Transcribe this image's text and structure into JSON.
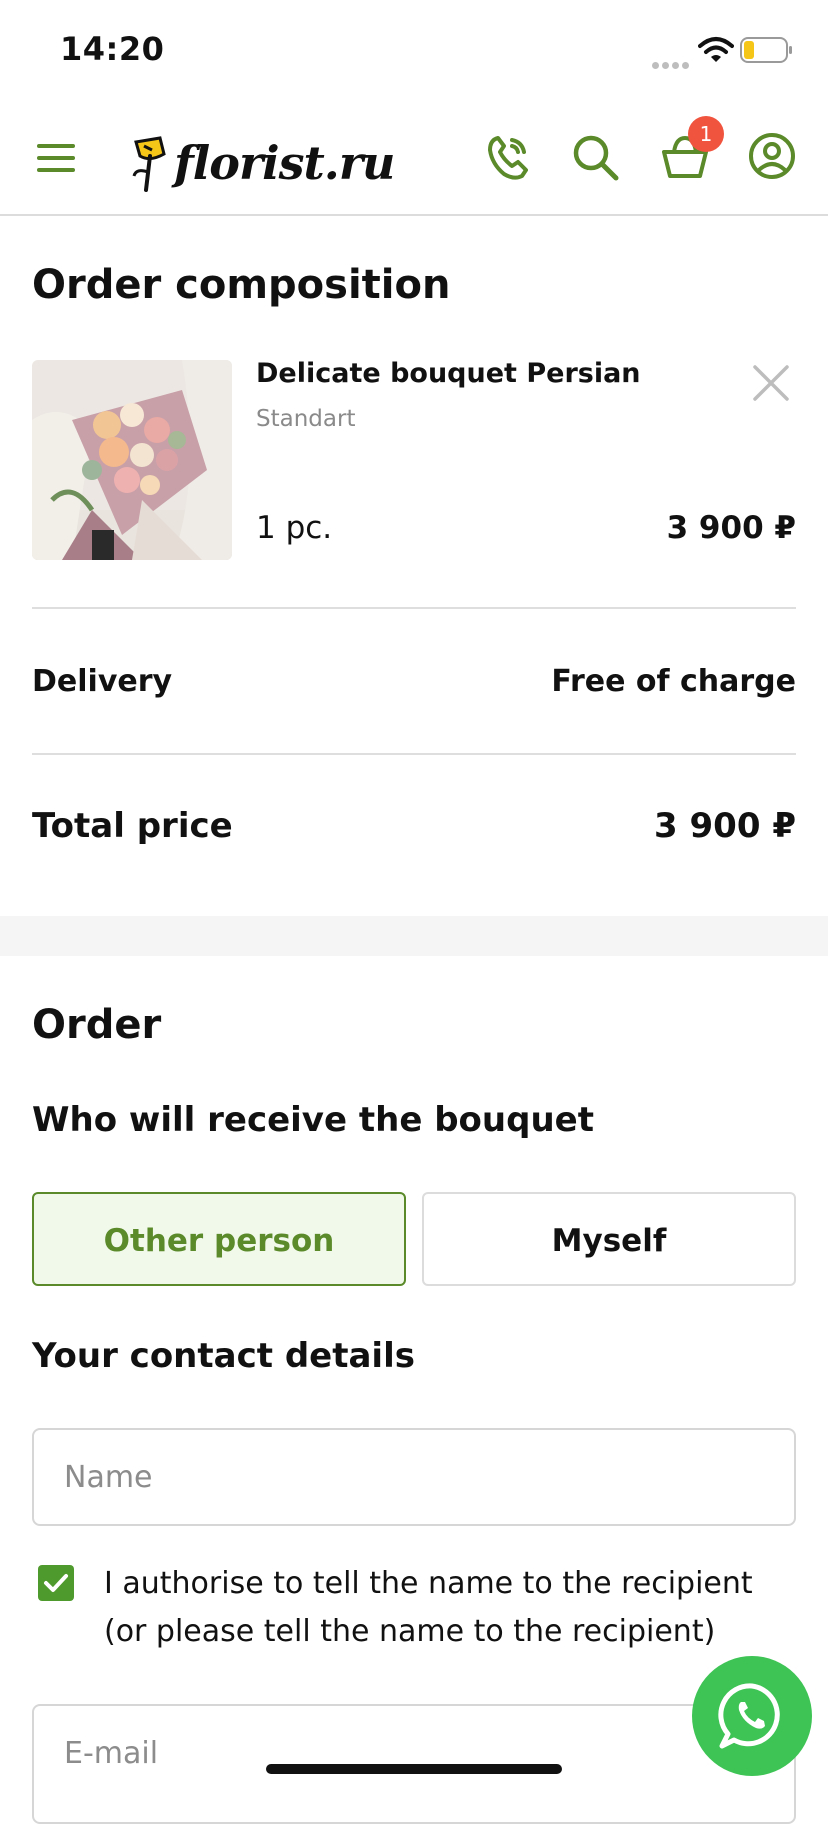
{
  "status_bar": {
    "time": "14:20"
  },
  "header": {
    "logo_text": "florist.ru",
    "cart_count": "1",
    "accent_color": "#5a8a2a",
    "badge_color": "#f0533e",
    "icons": [
      "menu-icon",
      "flower-logo-icon",
      "phone-icon",
      "search-icon",
      "basket-icon",
      "account-icon"
    ]
  },
  "order_composition": {
    "title": "Order composition",
    "item": {
      "name": "Delicate bouquet Persian",
      "variant": "Standart",
      "quantity": "1 pc.",
      "price": "3 900 ₽"
    },
    "delivery_label": "Delivery",
    "delivery_value": "Free of charge",
    "total_label": "Total price",
    "total_value": "3 900 ₽"
  },
  "order": {
    "title": "Order",
    "recipient_heading": "Who will receive the bouquet",
    "recipient_options": [
      "Other person",
      "Myself"
    ],
    "selected_option": "Other person",
    "contact_heading": "Your contact details",
    "name_placeholder": "Name",
    "authorise_checked": true,
    "authorise_text": "I authorise to tell the name to the recipient (or please tell the name to the recipient)",
    "email_placeholder": "E-mail"
  },
  "floating": {
    "whatsapp_icon": "whatsapp-icon",
    "whatsapp_color": "#3ec455"
  }
}
